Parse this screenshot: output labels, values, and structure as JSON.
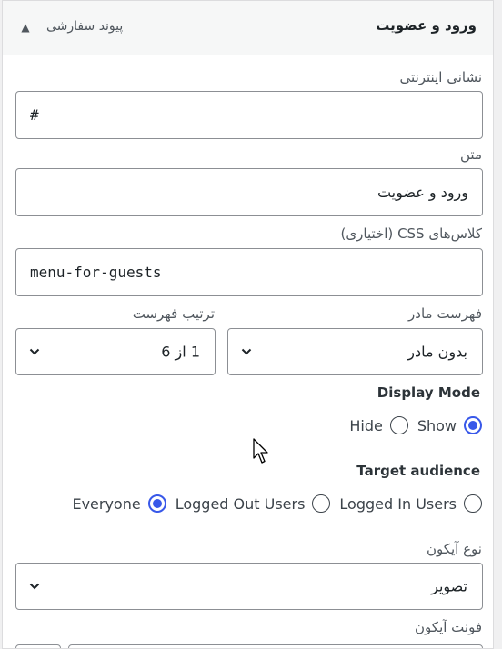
{
  "header": {
    "title": "ورود و عضویت",
    "item_type": "پیوند سفارشی",
    "toggle_icon": "triangle-up-icon"
  },
  "fields": {
    "url_label": "نشانی اینترنتی",
    "url_value": "#",
    "text_label": "متن",
    "text_value": "ورود و عضویت",
    "css_label": "کلاس‌های CSS (اختیاری)",
    "css_value": "menu-for-guests",
    "parent_label": "فهرست مادر",
    "parent_value": "بدون مادر",
    "order_label": "ترتیب فهرست",
    "order_value": "1 از 6"
  },
  "display_mode": {
    "label": "Display Mode",
    "options": [
      {
        "label": "Hide",
        "checked": false
      },
      {
        "label": "Show",
        "checked": true
      }
    ]
  },
  "target_audience": {
    "label": "Target audience",
    "options": [
      {
        "label": "Everyone",
        "checked": true
      },
      {
        "label": "Logged Out Users",
        "checked": false
      },
      {
        "label": "Logged In Users",
        "checked": false
      }
    ]
  },
  "icon_type": {
    "label": "نوع آیکون",
    "value": "تصویر"
  },
  "icon_font": {
    "label": "فونت آیکون"
  },
  "colors": {
    "accent": "#3858e9",
    "border": "#8c8f94"
  }
}
